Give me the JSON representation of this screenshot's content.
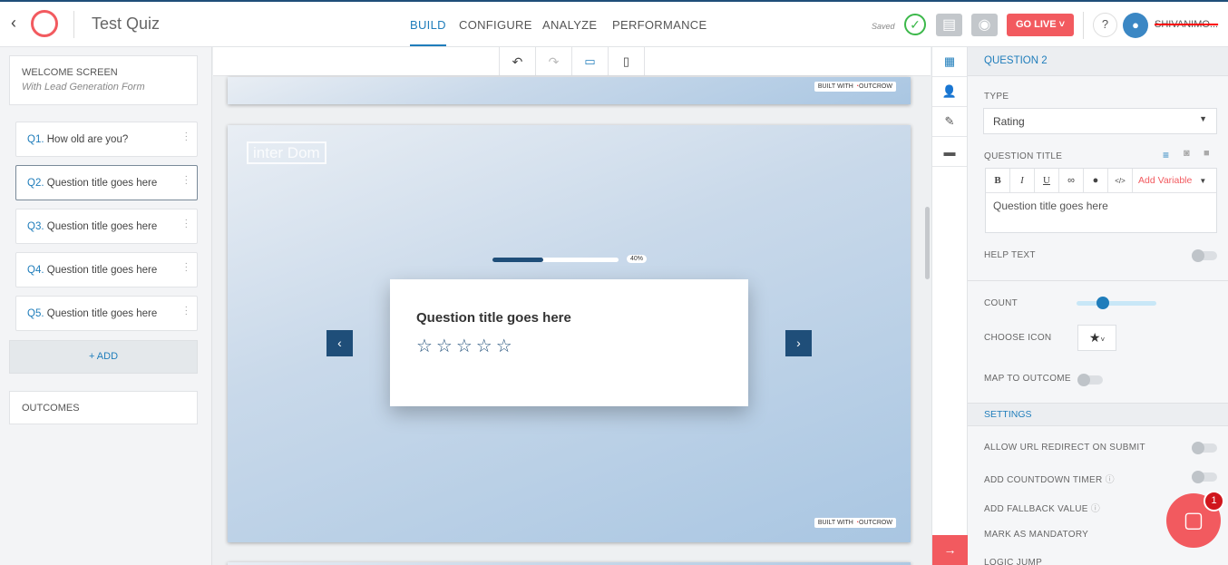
{
  "header": {
    "title": "Test Quiz",
    "tabs": [
      "BUILD",
      "CONFIGURE",
      "ANALYZE",
      "PERFORMANCE"
    ],
    "saved": "Saved",
    "go_live": "GO LIVE",
    "help": "?",
    "user": "SHIVANIMO..."
  },
  "left": {
    "welcome": {
      "title": "WELCOME SCREEN",
      "subtitle": "With Lead Generation Form"
    },
    "questions": [
      {
        "num": "Q1.",
        "text": "How old are you?"
      },
      {
        "num": "Q2.",
        "text": "Question title goes here"
      },
      {
        "num": "Q3.",
        "text": "Question title goes here"
      },
      {
        "num": "Q4.",
        "text": "Question title goes here"
      },
      {
        "num": "Q5.",
        "text": "Question title goes here"
      }
    ],
    "add": "+ ADD",
    "outcomes": "OUTCOMES"
  },
  "canvas": {
    "built_with": "BUILT WITH",
    "brand": "OUTCROW",
    "logo": "inter Dom",
    "progress_label": "40%",
    "progress": 0.4,
    "question": "Question title goes here",
    "stars": 5
  },
  "right": {
    "heading": "QUESTION 2",
    "type_label": "TYPE",
    "type_value": "Rating",
    "qtitle_label": "QUESTION TITLE",
    "add_variable": "Add Variable",
    "qtitle_value": "Question title goes here",
    "help_text": "HELP TEXT",
    "count": "COUNT",
    "count_value": 0.3,
    "choose_icon": "CHOOSE ICON",
    "map_outcome": "MAP TO OUTCOME",
    "settings": "SETTINGS",
    "allow_redirect": "ALLOW URL REDIRECT ON SUBMIT",
    "countdown": "ADD COUNTDOWN TIMER",
    "fallback": "ADD FALLBACK VALUE",
    "mandatory": "MARK AS MANDATORY",
    "logic": "LOGIC JUMP"
  },
  "chat": {
    "badge": "1"
  },
  "colors": {
    "accent": "#1f7dbb",
    "live": "#f25a5f",
    "nav": "#1f4e79"
  }
}
